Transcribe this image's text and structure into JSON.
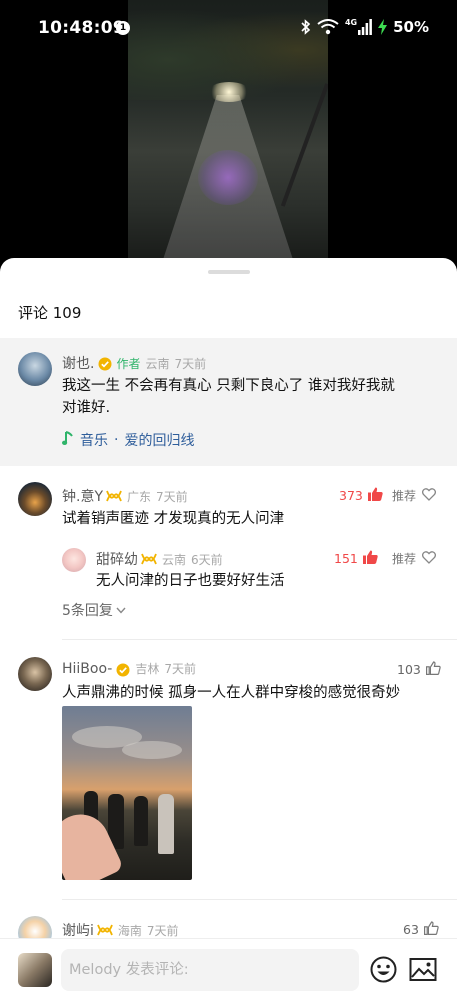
{
  "status_bar": {
    "time": "10:48:09",
    "notification_count": "1",
    "network": "4G",
    "battery": "50%"
  },
  "sheet": {
    "title": "评论 109"
  },
  "comments": [
    {
      "name": "谢也.",
      "author_tag": "作者",
      "location": "云南",
      "time": "7天前",
      "text_lines": [
        "我这一生 不会再有真心 只剩下良心了 谁对我好我就",
        "对谁好."
      ],
      "music": {
        "label": "音乐",
        "separator": "·",
        "song": "爱的回归线"
      }
    },
    {
      "name": "钟.意Y",
      "location": "广东",
      "time": "7天前",
      "likes": "373",
      "recommend": "推荐",
      "text": "试着销声匿迹 才发现真的无人问津",
      "reply": {
        "name": "甜碎幼",
        "location": "云南",
        "time": "6天前",
        "likes": "151",
        "recommend": "推荐",
        "text": "无人问津的日子也要好好生活"
      },
      "more_replies": "5条回复"
    },
    {
      "name": "HiiBoo-",
      "location": "吉林",
      "time": "7天前",
      "likes": "103",
      "text": "人声鼎沸的时候 孤身一人在人群中穿梭的感觉很奇妙"
    },
    {
      "name": "谢屿i",
      "location": "海南",
      "time": "7天前",
      "likes": "63"
    }
  ],
  "input": {
    "placeholder": "Melody 发表评论:"
  },
  "colors": {
    "like_active": "#f04848",
    "author_green": "#2fb46a",
    "verified_gold": "#f2b400",
    "music_link": "#2f5e9b"
  },
  "icons": [
    "bluetooth-icon",
    "wifi-icon",
    "signal-icon",
    "charging-icon",
    "verified-icon",
    "vip-badge-icon",
    "music-note-icon",
    "thumbs-up-icon",
    "heart-icon",
    "chevron-down-icon",
    "emoji-icon",
    "image-icon"
  ]
}
